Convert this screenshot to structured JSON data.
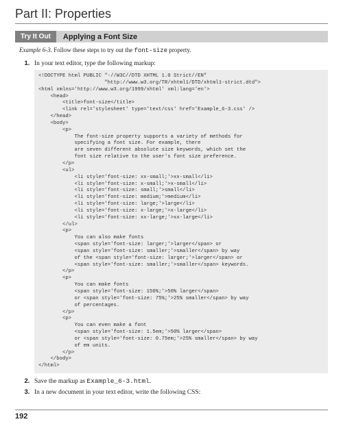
{
  "part_title": "Part II: Properties",
  "tryit": {
    "label": "Try It Out",
    "topic": "Applying a Font Size"
  },
  "example_prefix": "Example 6-3.",
  "example_rest": " Follow these steps to try out the ",
  "example_code": "font-size",
  "example_tail": " property.",
  "steps": {
    "s1": "In your text editor, type the following markup:",
    "s2_a": "Save the markup as ",
    "s2_b": "Example_6-3.html",
    "s2_c": ".",
    "s3": "In a new document in your text editor, write the following CSS:"
  },
  "code": "<!DOCTYPE html PUBLIC \"-//W3C//DTD XHTML 1.0 Strict//EN\"\n                      \"http://www.w3.org/TR/xhtml1/DTD/xhtml1-strict.dtd\">\n<html xmlns='http://www.w3.org/1999/xhtml' xml:lang='en'>\n    <head>\n        <title>font-size</title>\n        <link rel='stylesheet' type='text/css' href='Example_6-3.css' />\n    </head>\n    <body>\n        <p>\n            The font-size property supports a variety of methods for\n            specifying a font size. For example, there\n            are seven different absolute size keywords, which set the\n            font size relative to the user's font size preference.\n        </p>\n        <ul>\n            <li style='font-size: xx-small;'>xx-small</li>\n            <li style='font-size: x-small;'>x-small</li>\n            <li style='font-size: small;'>small</li>\n            <li style='font-size: medium;'>medium</li>\n            <li style='font-size: large;'>large</li>\n            <li style='font-size: x-large;'>x-large</li>\n            <li style='font-size: xx-large;'>xx-large</li>\n        </ul>\n        <p>\n            You can also make fonts\n            <span style='font-size: larger;'>larger</span> or\n            <span style='font-size: smaller;'>smaller</span> by way\n            of the <span style='font-size: larger;'>larger</span> or\n            <span style='font-size: smaller;'>smaller</span> keywords.\n        </p>\n        <p>\n            You can make fonts\n            <span style='font-size: 150%;'>50% larger</span>\n            or <span style='font-size: 75%;'>25% smaller</span> by way\n            of percentages.\n        </p>\n        <p>\n            You can even make a font\n            <span style='font-size: 1.5em;'>50% larger</span>\n            or <span style='font-size: 0.75em;'>25% smaller</span> by way\n            of em units.\n        </p>\n    </body>\n</html>",
  "page_number": "192"
}
